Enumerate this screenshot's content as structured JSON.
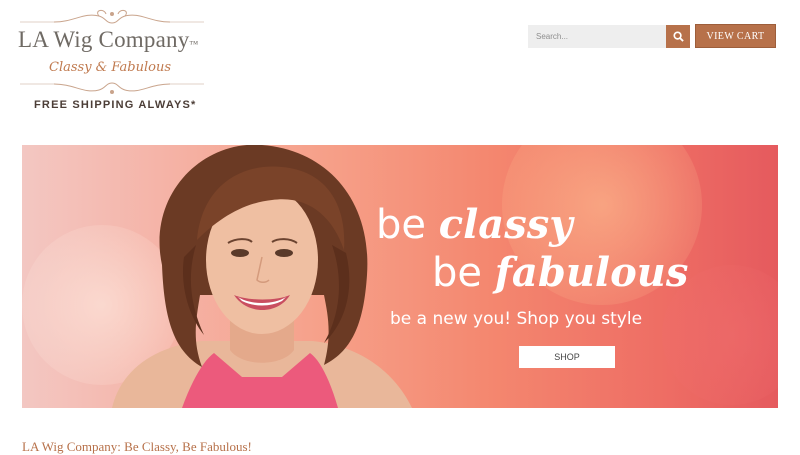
{
  "header": {
    "brand": "LA Wig Company",
    "trademark": "™",
    "tagline": "Classy & Fabulous",
    "shipping": "FREE SHIPPING ALWAYS*"
  },
  "search": {
    "placeholder": "Search...",
    "icon": "search-icon"
  },
  "cart": {
    "label": "VIEW CART"
  },
  "hero": {
    "line1_plain": "be ",
    "line1_script": "classy",
    "line2_plain": "be ",
    "line2_script": "fabulous",
    "subtitle": "be a new you! Shop you style",
    "shop_label": "SHOP"
  },
  "content": {
    "heading": "LA Wig Company: Be Classy, Be Fabulous!"
  },
  "colors": {
    "accent": "#b7714a",
    "tagline": "#c07a4f",
    "hero_pink": "#f4876f"
  }
}
